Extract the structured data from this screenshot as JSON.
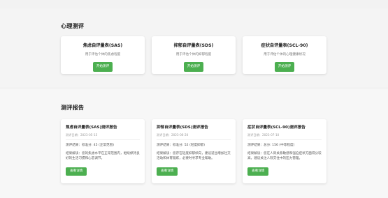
{
  "assessments": {
    "title": "心理测评",
    "tests": [
      {
        "name": "焦虑自评量表(SAS)",
        "description": "用于评估个体的焦虑程度",
        "button": "开始测评"
      },
      {
        "name": "抑郁自评量表(SDS)",
        "description": "用于评估个体的抑郁程度",
        "button": "开始测评"
      },
      {
        "name": "症状自评量表(SCL-90)",
        "description": "用于评估个体的心理健康状况",
        "button": "开始测评"
      }
    ]
  },
  "reports": {
    "title": "测评报告",
    "items": [
      {
        "title": "焦虑自评量表(SAS)测评报告",
        "date": "测评日期：2023-05-15",
        "result": "测评结果：标准分: 45 (正常范围)",
        "interpretation": "结果解读：您的焦虑水平在正常范围内，继续保持良好的生活习惯和心态调节。",
        "button": "查看详情"
      },
      {
        "title": "抑郁自评量表(SDS)测评报告",
        "date": "测评日期：2023-06-20",
        "result": "测评结果：标准分: 52 (轻度抑郁)",
        "interpretation": "结果解读：您存在轻度抑郁倾向，建议适当增加社交活动和体育锻炼，必要时寻求专业帮助。",
        "button": "查看详情"
      },
      {
        "title": "症状自评量表(SCL-90)测评报告",
        "date": "测评日期：2023-07-10",
        "result": "测评结果：总分: 156 (中等程度)",
        "interpretation": "结果解读：您在人际关系敏感和强迫症状方面得分较高，建议关注人际交往中的压力管理。",
        "button": "查看详情"
      }
    ]
  },
  "colors": {
    "accent": "#4caf50"
  }
}
